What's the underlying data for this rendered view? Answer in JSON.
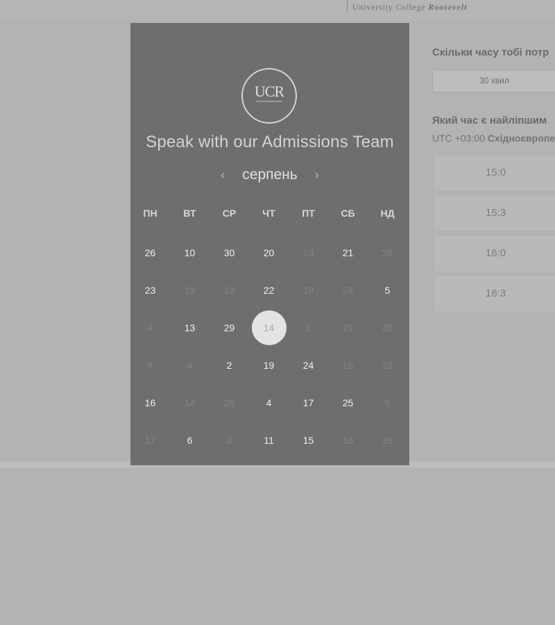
{
  "header": {
    "brand_university": "University College",
    "brand_name": "Roosevelt"
  },
  "panel": {
    "logo_text": "UCR",
    "title": "Speak with our Admissions Team",
    "month": "серпень",
    "weekdays": [
      "ПН",
      "ВТ",
      "СР",
      "ЧТ",
      "ПТ",
      "СБ",
      "НД"
    ],
    "days": [
      {
        "label": "26",
        "muted": false
      },
      {
        "label": "10",
        "muted": false
      },
      {
        "label": "30",
        "muted": false
      },
      {
        "label": "20",
        "muted": false
      },
      {
        "label": "23",
        "muted": true
      },
      {
        "label": "21",
        "muted": false
      },
      {
        "label": "26",
        "muted": true
      },
      {
        "label": "23",
        "muted": false
      },
      {
        "label": "19",
        "muted": true
      },
      {
        "label": "18",
        "muted": true
      },
      {
        "label": "22",
        "muted": false
      },
      {
        "label": "18",
        "muted": true
      },
      {
        "label": "24",
        "muted": true
      },
      {
        "label": "5",
        "muted": false
      },
      {
        "label": "4",
        "muted": true
      },
      {
        "label": "13",
        "muted": false
      },
      {
        "label": "29",
        "muted": false
      },
      {
        "label": "14",
        "muted": false,
        "selected": true
      },
      {
        "label": "1",
        "muted": true
      },
      {
        "label": "21",
        "muted": true
      },
      {
        "label": "20",
        "muted": true
      },
      {
        "label": "6",
        "muted": true
      },
      {
        "label": "4",
        "muted": true
      },
      {
        "label": "2",
        "muted": false
      },
      {
        "label": "19",
        "muted": false
      },
      {
        "label": "24",
        "muted": false
      },
      {
        "label": "16",
        "muted": true
      },
      {
        "label": "23",
        "muted": true
      },
      {
        "label": "16",
        "muted": false
      },
      {
        "label": "14",
        "muted": true
      },
      {
        "label": "26",
        "muted": true
      },
      {
        "label": "4",
        "muted": false
      },
      {
        "label": "17",
        "muted": false
      },
      {
        "label": "25",
        "muted": false
      },
      {
        "label": "5",
        "muted": true
      },
      {
        "label": "17",
        "muted": true
      },
      {
        "label": "6",
        "muted": false
      },
      {
        "label": "4",
        "muted": true
      },
      {
        "label": "11",
        "muted": false
      },
      {
        "label": "15",
        "muted": false
      },
      {
        "label": "16",
        "muted": true
      },
      {
        "label": "28",
        "muted": true
      }
    ]
  },
  "scheduler": {
    "duration_question": "Скільки часу тобі потр",
    "duration_value": "30 хвил",
    "time_question": "Який час є найліпшим",
    "timezone_offset": "UTC +03:00",
    "timezone_name": "Східноєвропе",
    "time_slots": [
      "15:0",
      "15:3",
      "16:0",
      "16:3"
    ]
  }
}
